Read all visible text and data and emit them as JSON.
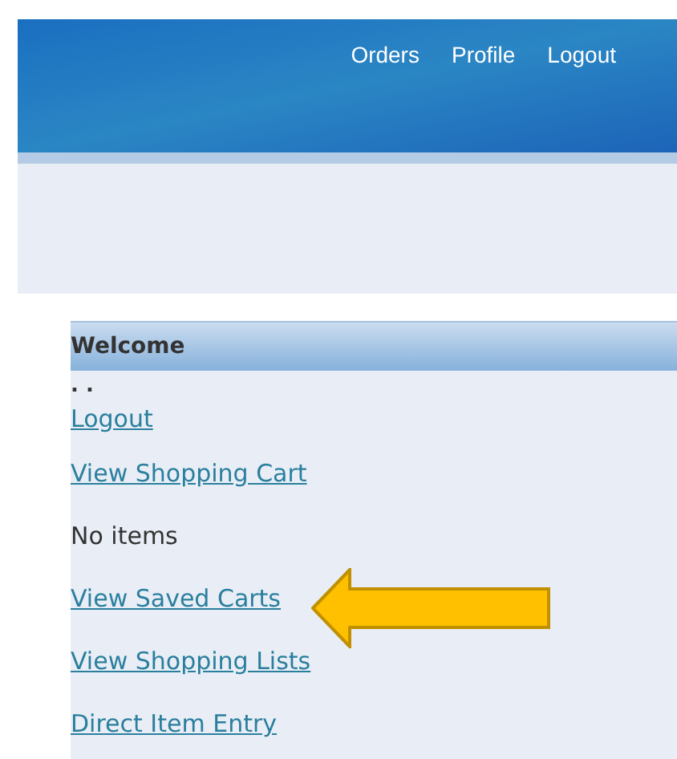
{
  "header": {
    "nav": [
      "Orders",
      "Profile",
      "Logout"
    ]
  },
  "panel": {
    "title": "Welcome",
    "items": [
      {
        "kind": "text",
        "text": ". ."
      },
      {
        "kind": "link",
        "text": "Logout"
      },
      {
        "kind": "link",
        "text": "View Shopping Cart"
      },
      {
        "kind": "text",
        "text": "No items"
      },
      {
        "kind": "link",
        "text": "View Saved Carts",
        "pointer": true
      },
      {
        "kind": "link",
        "text": "View Shopping Lists"
      },
      {
        "kind": "link",
        "text": "Direct Item Entry"
      }
    ]
  }
}
